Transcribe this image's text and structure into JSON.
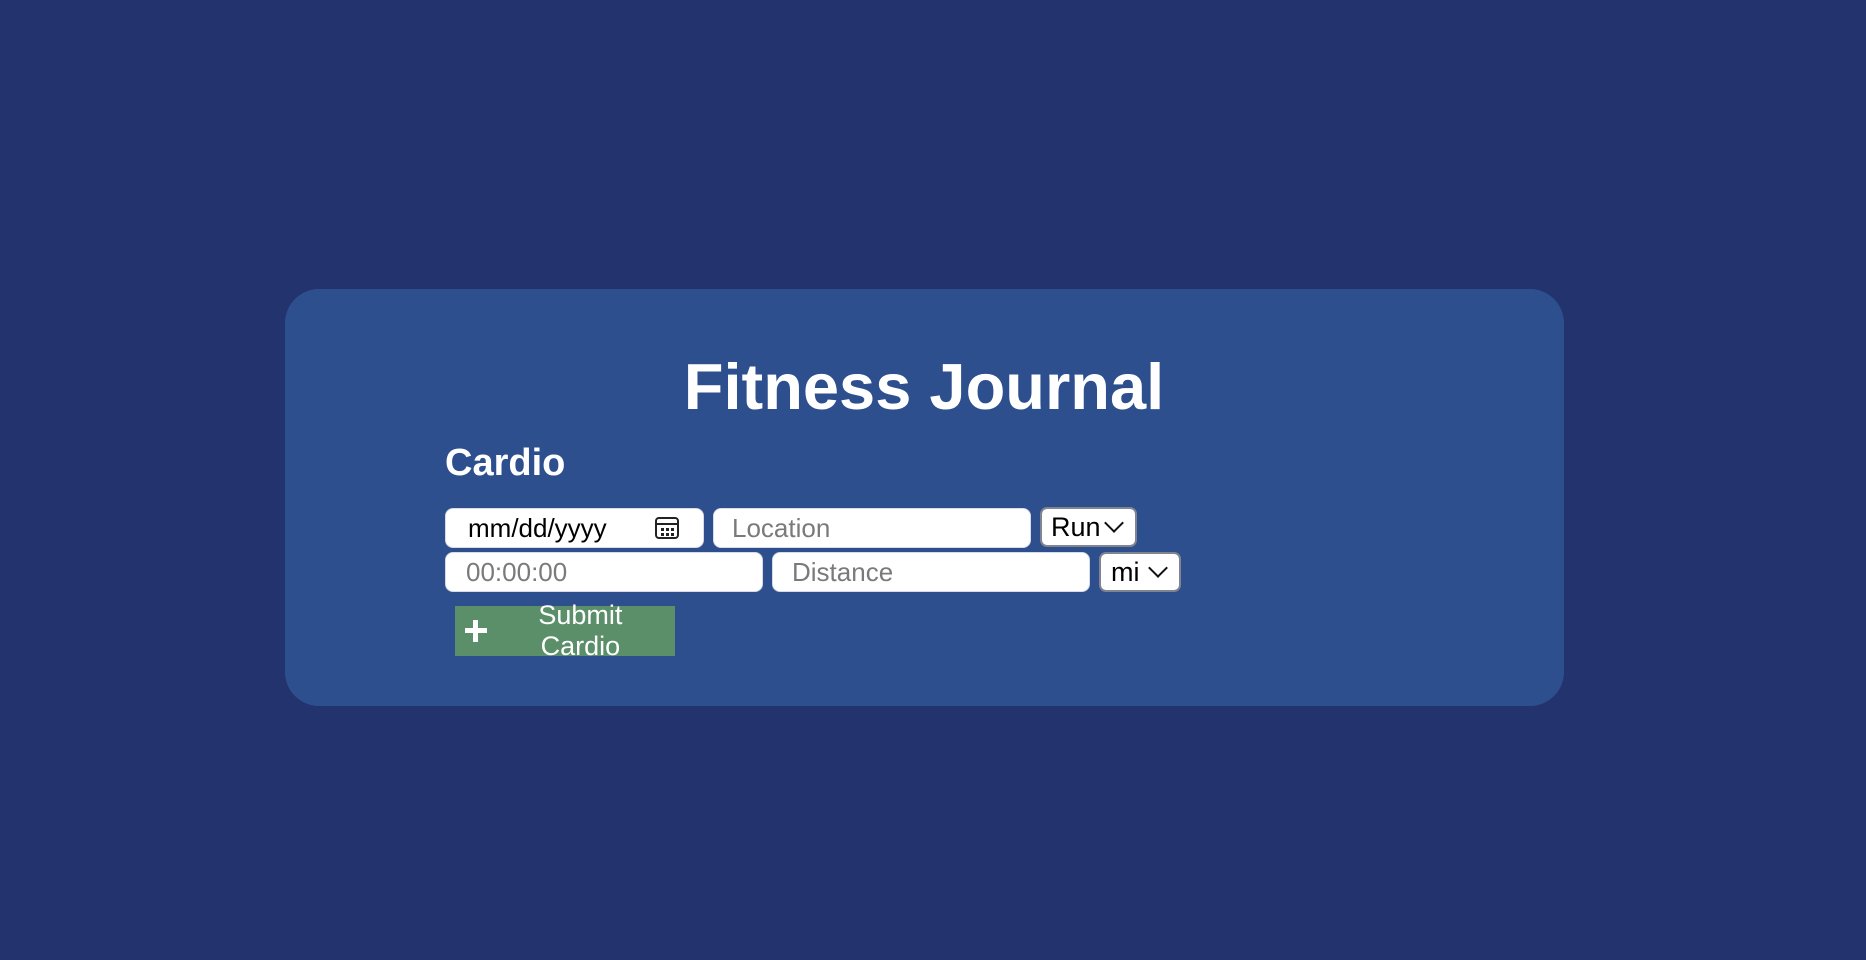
{
  "header": {
    "title": "Fitness Journal"
  },
  "cardio": {
    "heading": "Cardio",
    "date": {
      "value": "mm/dd/yyyy",
      "icon": "calendar-icon"
    },
    "location": {
      "value": "",
      "placeholder": "Location"
    },
    "activity": {
      "selected": "Run",
      "icon": "chevron-down-icon"
    },
    "duration": {
      "value": "",
      "placeholder": "00:00:00"
    },
    "distance": {
      "value": "",
      "placeholder": "Distance"
    },
    "unit": {
      "selected": "mi",
      "icon": "chevron-down-icon"
    },
    "submit": {
      "label": "Submit Cardio",
      "icon": "plus-icon"
    }
  },
  "colors": {
    "page_background": "#22336e",
    "card_background": "#2e4f8e",
    "submit_button": "#5b8f6a",
    "text_light": "#ffffff"
  }
}
